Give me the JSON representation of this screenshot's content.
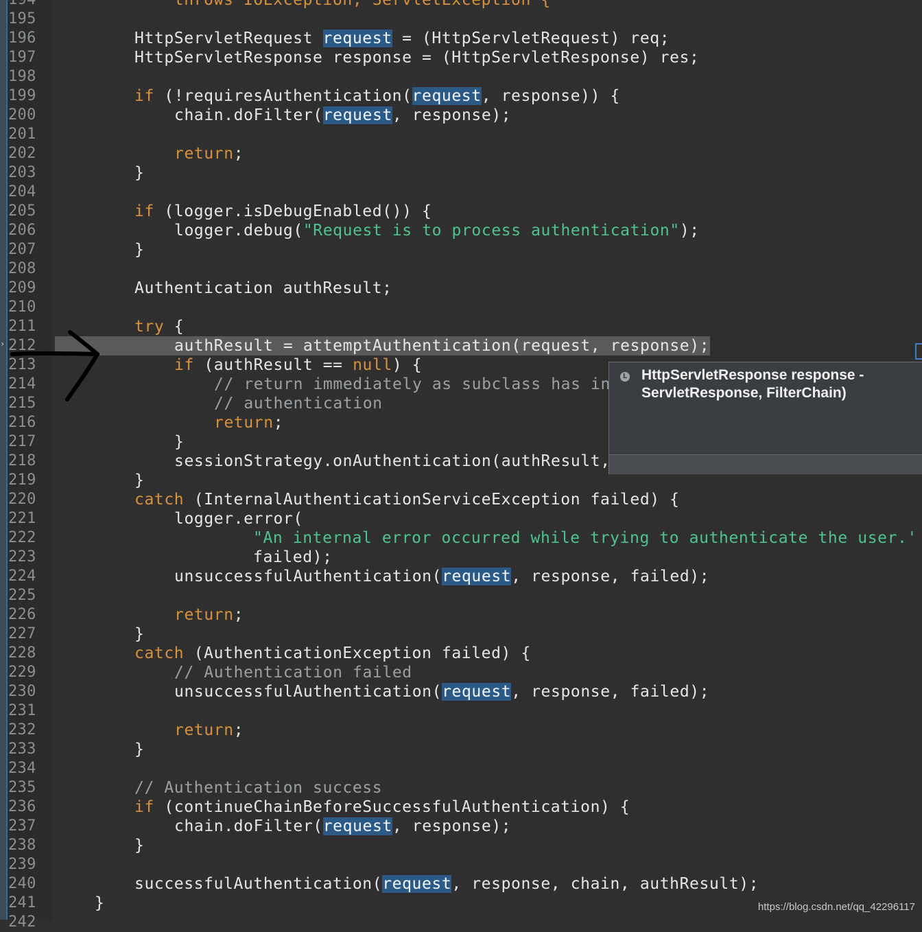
{
  "gutter": {
    "line_numbers": [
      "194",
      "195",
      "196",
      "197",
      "198",
      "199",
      "200",
      "201",
      "202",
      "203",
      "204",
      "205",
      "206",
      "207",
      "208",
      "209",
      "210",
      "211",
      "212",
      "213",
      "214",
      "215",
      "216",
      "217",
      "218",
      "219",
      "220",
      "221",
      "222",
      "223",
      "224",
      "225",
      "226",
      "227",
      "228",
      "229",
      "230",
      "231",
      "232",
      "233",
      "234",
      "235",
      "236",
      "237",
      "238",
      "239",
      "240",
      "241",
      "242"
    ]
  },
  "code": {
    "l194": "    throws IOException, ServletException {",
    "l196a": "HttpServletRequest ",
    "l196b": "request",
    "l196c": " = (HttpServletRequest) req;",
    "l197": "HttpServletResponse response = (HttpServletResponse) res;",
    "kw_if": "if",
    "kw_return": "return",
    "kw_try": "try",
    "kw_catch": "catch",
    "kw_null": "null",
    "req": "request",
    "semi": ";",
    "brace": "}",
    "l199a": " (!requiresAuthentication(",
    "l199b": ", response)) {",
    "l200a": "chain.doFilter(",
    "l200b": ", response);",
    "l205": " (logger.isDebugEnabled()) {",
    "l206a": "logger.debug(",
    "l206b": "\"Request is to process authentication\"",
    "l206c": ");",
    "l209": "Authentication authResult;",
    "l211": " {",
    "l212": "authResult = attemptAuthentication(request, response);",
    "l213a": " (authResult == ",
    "l213b": ") {",
    "l214": "// return immediately as subclass has in",
    "l215": "// authentication",
    "l218": "sessionStrategy.onAuthentication(authResult,",
    "l220": " (InternalAuthenticationServiceException failed) {",
    "l221": "logger.error(",
    "l222": "\"An internal error occurred while trying to authenticate the user.'",
    "l223": "failed);",
    "l224a": "unsuccessfulAuthentication(",
    "l224b": ", response, failed);",
    "l228": " (AuthenticationException failed) {",
    "l229": "// Authentication failed",
    "l235": "// Authentication success",
    "l236": " (continueChainBeforeSuccessfulAuthentication) {",
    "l240a": "successfulAuthentication(",
    "l240b": ", response, chain, authResult);"
  },
  "hover_popup": {
    "icon": "L",
    "text": "HttpServletResponse response -\nServletResponse, FilterChain)"
  },
  "watermark": "https://blog.csdn.net/qq_42296117"
}
